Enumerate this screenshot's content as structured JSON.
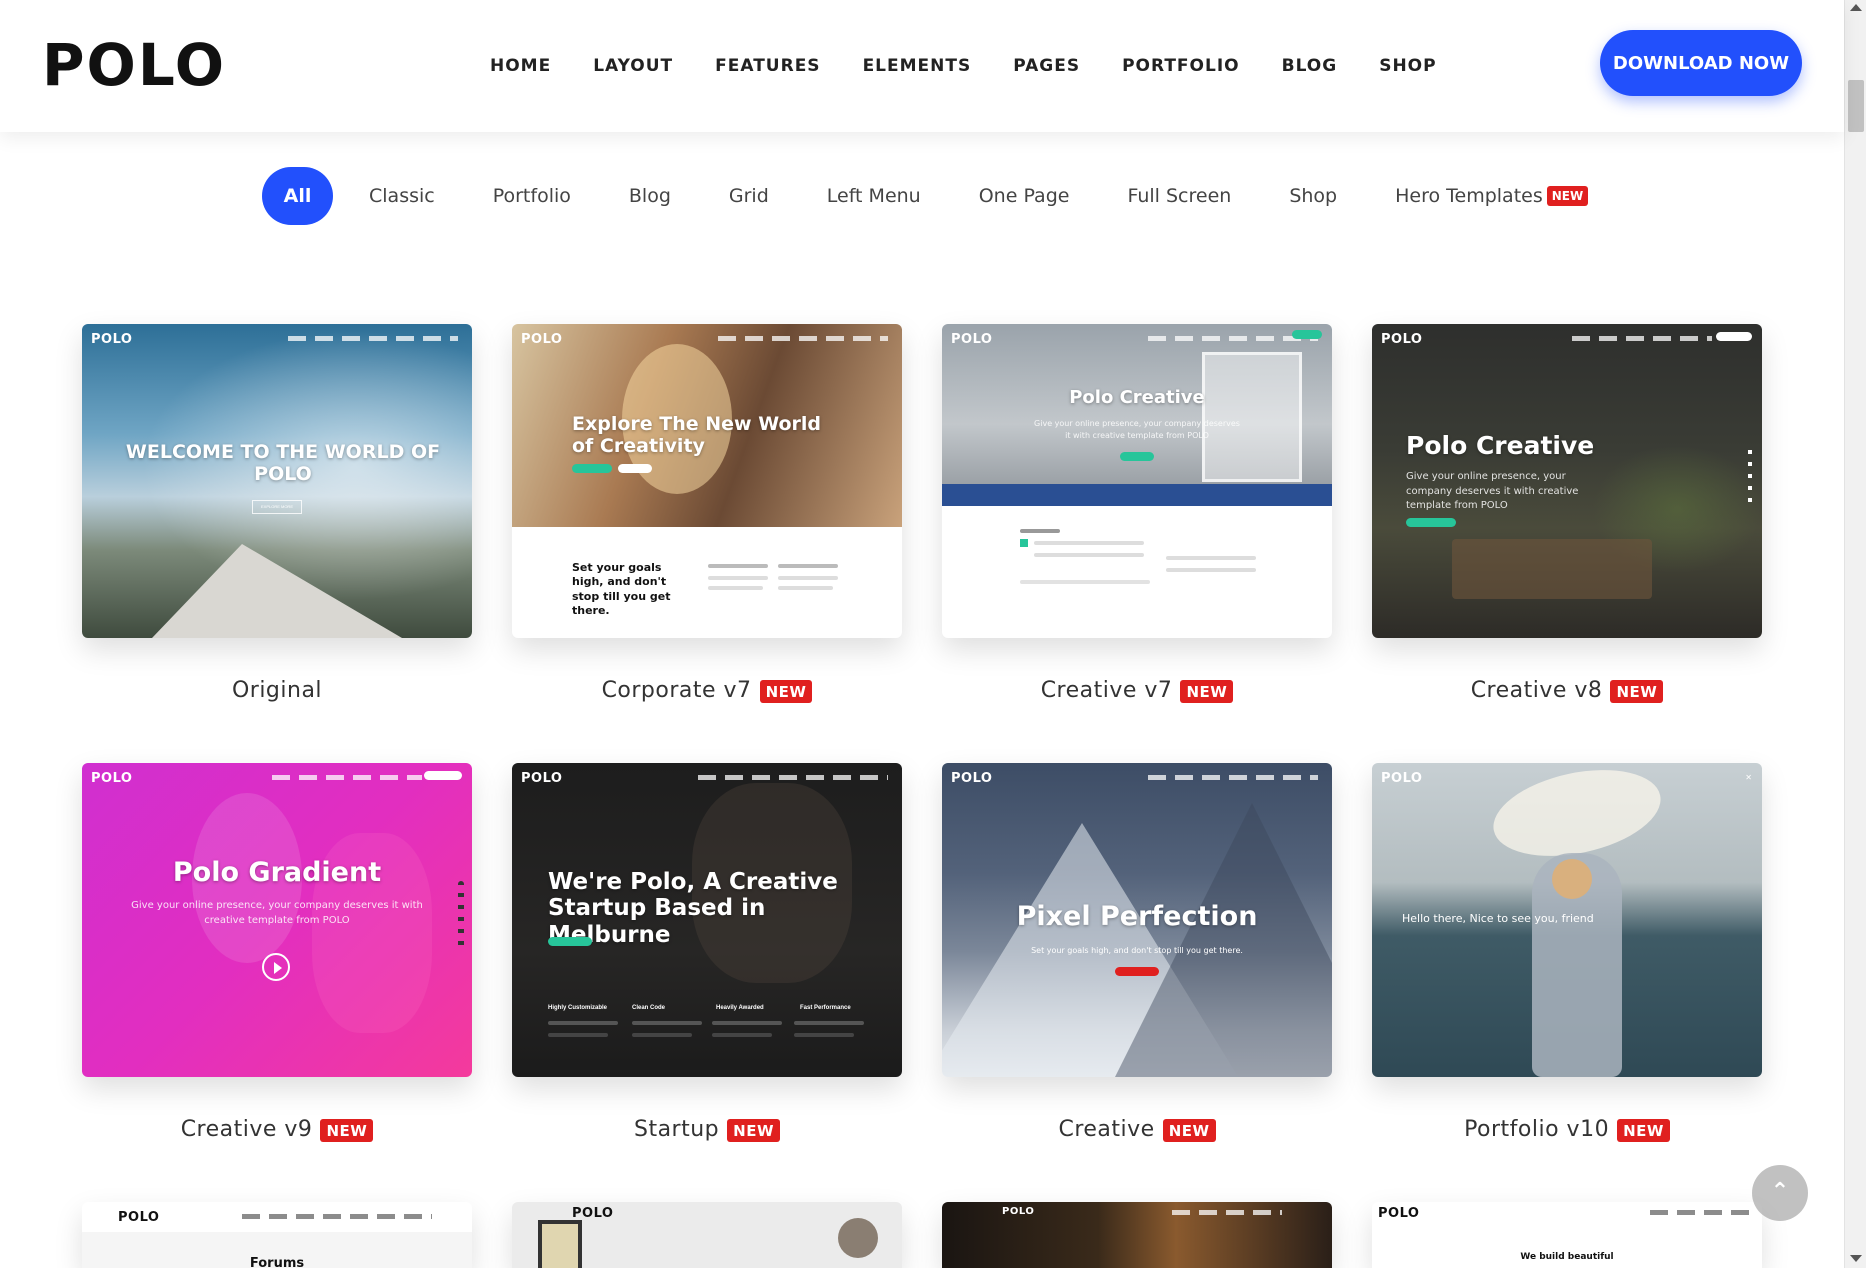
{
  "header": {
    "logo": "POLO",
    "nav": [
      "HOME",
      "LAYOUT",
      "FEATURES",
      "ELEMENTS",
      "PAGES",
      "PORTFOLIO",
      "BLOG",
      "SHOP"
    ],
    "download_label": "DOWNLOAD NOW",
    "accent_color": "#2250fc"
  },
  "filters": {
    "items": [
      "All",
      "Classic",
      "Portfolio",
      "Blog",
      "Grid",
      "Left Menu",
      "One Page",
      "Full Screen",
      "Shop",
      "Hero Templates"
    ],
    "active": "All",
    "new_badge": "NEW"
  },
  "cards": [
    {
      "label": "Original",
      "new": false,
      "logo": "POLO",
      "hero": "WELCOME TO THE WORLD OF POLO",
      "button": "EXPLORE MORE"
    },
    {
      "label": "Corporate v7",
      "new": true,
      "logo": "POLO",
      "hero": "Explore The New World of Creativity",
      "body_title": "Set your goals high, and don't stop till you get there."
    },
    {
      "label": "Creative v7",
      "new": true,
      "logo": "POLO",
      "hero": "Polo Creative",
      "sub": "Give your online presence, your company deserves it with creative template from POLO"
    },
    {
      "label": "Creative v8",
      "new": true,
      "logo": "POLO",
      "hero": "Polo Creative",
      "sub": "Give your online presence, your company deserves it with creative template from POLO"
    },
    {
      "label": "Creative v9",
      "new": true,
      "logo": "POLO",
      "hero": "Polo Gradient",
      "sub": "Give your online presence, your company deserves it with creative template from POLO"
    },
    {
      "label": "Startup",
      "new": true,
      "logo": "POLO",
      "hero": "We're Polo, A Creative Startup Based in Melburne",
      "features": [
        "Highly Customizable",
        "Clean Code",
        "Heavily Awarded",
        "Fast Performance"
      ]
    },
    {
      "label": "Creative",
      "new": true,
      "logo": "POLO",
      "hero": "Pixel Perfection",
      "sub": "Set your goals high, and don't stop till you get there."
    },
    {
      "label": "Portfolio v10",
      "new": true,
      "logo": "POLO",
      "hero": "Hello there, Nice to see you, friend"
    }
  ],
  "bottom_row": [
    {
      "logo": "POLO",
      "title": "Forums"
    },
    {
      "logo": "POLO",
      "title": ""
    },
    {
      "logo": "POLO",
      "title": ""
    },
    {
      "logo": "POLO",
      "title": "We build beautiful"
    }
  ],
  "scroll_top_icon": "chevron-up-icon"
}
